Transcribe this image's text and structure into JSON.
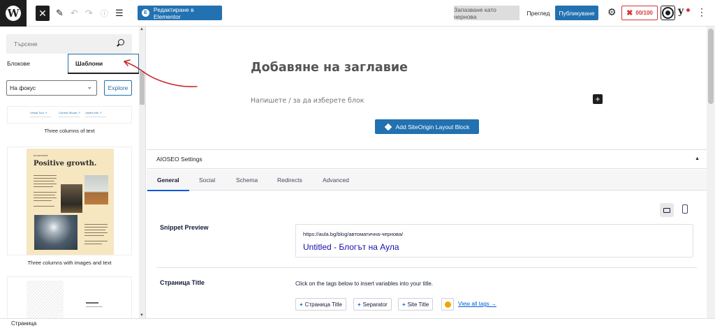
{
  "topbar": {
    "elementor_label": "Редактиране в Elementor",
    "save_draft_label": "Запазване като чернова",
    "preview_label": "Преглед",
    "publish_label": "Публикуване",
    "seo_score": "00/100"
  },
  "sidebar": {
    "search_placeholder": "Търсене",
    "tab_blocks": "Блокове",
    "tab_patterns": "Шаблони",
    "category_value": "На фокус",
    "explore_label": "Explore",
    "patterns": [
      {
        "label": "Three columns of text",
        "cols": [
          "Virtual Tour ↗",
          "Current Shows ↗",
          "Useful Info ↗"
        ]
      },
      {
        "label": "Three columns with images and text",
        "headline": "Positive growth.",
        "kicker": "ECOSYSTEM"
      },
      {
        "label": ""
      }
    ]
  },
  "editor": {
    "title_placeholder": "Добавяне на заглавие",
    "block_placeholder": "Напишете / за да изберете блок",
    "siteorigin_label": "Add SiteOrigin Layout Block"
  },
  "aioseo": {
    "header": "AIOSEO Settings",
    "tabs": [
      "General",
      "Social",
      "Schema",
      "Redirects",
      "Advanced"
    ],
    "snippet_label": "Snippet Preview",
    "snippet_url": "https://aula.bg/blog/автоматична-чернова/",
    "snippet_title": "Untitled - Блогът на Аула",
    "title_label": "Страница Title",
    "title_hint": "Click on the tags below to insert variables into your title.",
    "tags": [
      "Страница Title",
      "Separator",
      "Site Title"
    ],
    "view_all_tags": "View all tags →"
  },
  "statusbar": {
    "breadcrumb": "Страница"
  },
  "colors": {
    "accent": "#2271b1",
    "score_red": "#d63638",
    "annotation": "#c62828"
  }
}
